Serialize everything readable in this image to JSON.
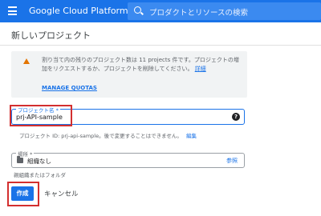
{
  "header": {
    "brand": "Google Cloud Platform",
    "search_placeholder": "プロダクトとリソースの検索"
  },
  "page": {
    "title": "新しいプロジェクト"
  },
  "warning": {
    "text": "割り当て内の残りのプロジェクト数は 11 projects 件です。プロジェクトの増加をリクエストするか、プロジェクトを削除してください。",
    "details_link": "詳細",
    "quota_link": "MANAGE QUOTAS"
  },
  "form": {
    "name_label": "プロジェクト名 *",
    "name_value": "prj-API-sample",
    "project_id_text": "プロジェクト ID: prj-api-sample。後で変更することはできません。",
    "edit_link": "編集",
    "location_label": "場所 *",
    "location_value": "組織なし",
    "browse_link": "参照",
    "location_hint": "親組織またはフォルダ"
  },
  "actions": {
    "create_label": "作成",
    "cancel_label": "キャンセル"
  },
  "colors": {
    "header_blue": "#1a73e8",
    "highlight_red": "#d32f2f",
    "warning_orange": "#e37400"
  }
}
